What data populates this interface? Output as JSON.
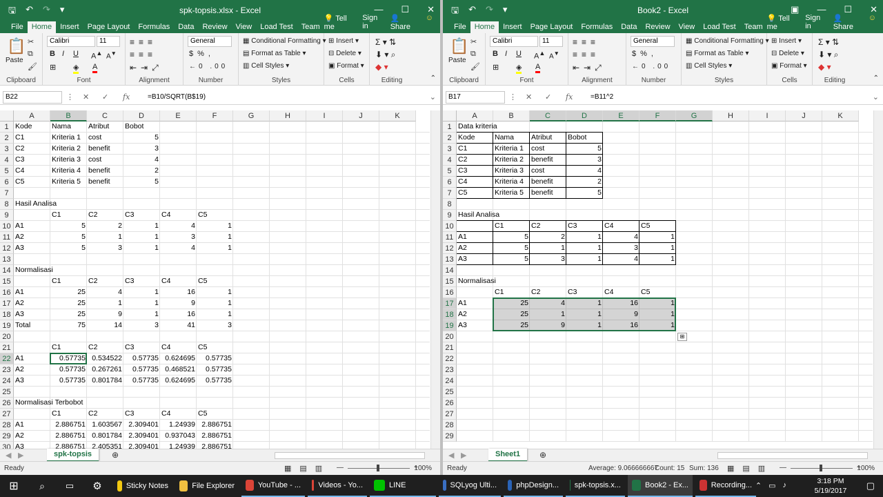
{
  "left": {
    "title": "spk-topsis.xlsx - Excel",
    "tabs": [
      "File",
      "Home",
      "Insert",
      "Page Layout",
      "Formulas",
      "Data",
      "Review",
      "View",
      "Load Test",
      "Team"
    ],
    "tell_me": "Tell me",
    "sign_in": "Sign in",
    "share": "Share",
    "ribbon": {
      "clipboard": "Clipboard",
      "paste": "Paste",
      "font_name": "Calibri",
      "font_size": "11",
      "font": "Font",
      "alignment": "Alignment",
      "number_format": "General",
      "number": "Number",
      "cond_fmt": "Conditional Formatting",
      "fmt_table": "Format as Table",
      "cell_styles": "Cell Styles",
      "styles": "Styles",
      "insert": "Insert",
      "delete": "Delete",
      "format": "Format",
      "cells": "Cells",
      "editing": "Editing"
    },
    "name_box": "B22",
    "formula": "=B10/SQRT(B$19)",
    "columns": [
      "A",
      "B",
      "C",
      "D",
      "E",
      "F",
      "G",
      "H",
      "I",
      "J",
      "K"
    ],
    "rows": [
      [
        "Kode",
        "Nama",
        "Atribut",
        "Bobot",
        "",
        ""
      ],
      [
        "C1",
        "Kriteria 1",
        "cost",
        "5",
        "",
        ""
      ],
      [
        "C2",
        "Kriteria 2",
        "benefit",
        "3",
        "",
        ""
      ],
      [
        "C3",
        "Kriteria 3",
        "cost",
        "4",
        "",
        ""
      ],
      [
        "C4",
        "Kriteria 4",
        "benefit",
        "2",
        "",
        ""
      ],
      [
        "C5",
        "Kriteria 5",
        "benefit",
        "5",
        "",
        ""
      ],
      [
        "",
        "",
        "",
        "",
        "",
        ""
      ],
      [
        "Hasil Analisa",
        "",
        "",
        "",
        "",
        ""
      ],
      [
        "",
        "C1",
        "C2",
        "C3",
        "C4",
        "C5"
      ],
      [
        "A1",
        "5",
        "2",
        "1",
        "4",
        "1"
      ],
      [
        "A2",
        "5",
        "1",
        "1",
        "3",
        "1"
      ],
      [
        "A3",
        "5",
        "3",
        "1",
        "4",
        "1"
      ],
      [
        "",
        "",
        "",
        "",
        "",
        ""
      ],
      [
        "Normalisasi",
        "",
        "",
        "",
        "",
        ""
      ],
      [
        "",
        "C1",
        "C2",
        "C3",
        "C4",
        "C5"
      ],
      [
        "A1",
        "25",
        "4",
        "1",
        "16",
        "1"
      ],
      [
        "A2",
        "25",
        "1",
        "1",
        "9",
        "1"
      ],
      [
        "A3",
        "25",
        "9",
        "1",
        "16",
        "1"
      ],
      [
        "Total",
        "75",
        "14",
        "3",
        "41",
        "3"
      ],
      [
        "",
        "",
        "",
        "",
        "",
        ""
      ],
      [
        "",
        "C1",
        "C2",
        "C3",
        "C4",
        "C5"
      ],
      [
        "A1",
        "0.57735",
        "0.534522",
        "0.57735",
        "0.624695",
        "0.57735"
      ],
      [
        "A2",
        "0.57735",
        "0.267261",
        "0.57735",
        "0.468521",
        "0.57735"
      ],
      [
        "A3",
        "0.57735",
        "0.801784",
        "0.57735",
        "0.624695",
        "0.57735"
      ],
      [
        "",
        "",
        "",
        "",
        "",
        ""
      ],
      [
        "Normalisasi Terbobot",
        "",
        "",
        "",
        "",
        ""
      ],
      [
        "",
        "C1",
        "C2",
        "C3",
        "C4",
        "C5"
      ],
      [
        "A1",
        "2.886751",
        "1.603567",
        "2.309401",
        "1.24939",
        "2.886751"
      ],
      [
        "A2",
        "2.886751",
        "0.801784",
        "2.309401",
        "0.937043",
        "2.886751"
      ],
      [
        "A3",
        "2.886751",
        "2.405351",
        "2.309401",
        "1.24939",
        "2.886751"
      ]
    ],
    "sheet_tab": "spk-topsis",
    "status": "Ready",
    "zoom": "100%"
  },
  "right": {
    "title": "Book2 - Excel",
    "tabs": [
      "File",
      "Home",
      "Insert",
      "Page Layout",
      "Formulas",
      "Data",
      "Review",
      "View",
      "Load Test",
      "Team"
    ],
    "tell_me": "Tell me",
    "sign_in": "Sign in",
    "share": "Share",
    "ribbon": {
      "clipboard": "Clipboard",
      "paste": "Paste",
      "font_name": "Calibri",
      "font_size": "11",
      "font": "Font",
      "alignment": "Alignment",
      "number_format": "General",
      "number": "Number",
      "cond_fmt": "Conditional Formatting",
      "fmt_table": "Format as Table",
      "cell_styles": "Cell Styles",
      "styles": "Styles",
      "insert": "Insert",
      "delete": "Delete",
      "format": "Format",
      "cells": "Cells",
      "editing": "Editing"
    },
    "name_box": "B17",
    "formula": "=B11^2",
    "columns": [
      "A",
      "B",
      "C",
      "D",
      "E",
      "F",
      "G",
      "H",
      "I",
      "J",
      "K"
    ],
    "rows": [
      [
        "Data kriteria",
        "",
        "",
        "",
        "",
        ""
      ],
      [
        "Kode",
        "Nama",
        "Atribut",
        "Bobot",
        "",
        ""
      ],
      [
        "C1",
        "Kriteria 1",
        "cost",
        "5",
        "",
        ""
      ],
      [
        "C2",
        "Kriteria 2",
        "benefit",
        "3",
        "",
        ""
      ],
      [
        "C3",
        "Kriteria 3",
        "cost",
        "4",
        "",
        ""
      ],
      [
        "C4",
        "Kriteria 4",
        "benefit",
        "2",
        "",
        ""
      ],
      [
        "C5",
        "Kriteria 5",
        "benefit",
        "5",
        "",
        ""
      ],
      [
        "",
        "",
        "",
        "",
        "",
        ""
      ],
      [
        "Hasil Analisa",
        "",
        "",
        "",
        "",
        ""
      ],
      [
        "",
        "C1",
        "C2",
        "C3",
        "C4",
        "C5"
      ],
      [
        "A1",
        "5",
        "2",
        "1",
        "4",
        "1"
      ],
      [
        "A2",
        "5",
        "1",
        "1",
        "3",
        "1"
      ],
      [
        "A3",
        "5",
        "3",
        "1",
        "4",
        "1"
      ],
      [
        "",
        "",
        "",
        "",
        "",
        ""
      ],
      [
        "Normalisasi",
        "",
        "",
        "",
        "",
        ""
      ],
      [
        "",
        "C1",
        "C2",
        "C3",
        "C4",
        "C5"
      ],
      [
        "A1",
        "25",
        "4",
        "1",
        "16",
        "1"
      ],
      [
        "A2",
        "25",
        "1",
        "1",
        "9",
        "1"
      ],
      [
        "A3",
        "25",
        "9",
        "1",
        "16",
        "1"
      ],
      [
        "",
        "",
        "",
        "",
        "",
        ""
      ],
      [
        "",
        "",
        "",
        "",
        "",
        ""
      ],
      [
        "",
        "",
        "",
        "",
        "",
        ""
      ],
      [
        "",
        "",
        "",
        "",
        "",
        ""
      ],
      [
        "",
        "",
        "",
        "",
        "",
        ""
      ],
      [
        "",
        "",
        "",
        "",
        "",
        ""
      ],
      [
        "",
        "",
        "",
        "",
        "",
        ""
      ],
      [
        "",
        "",
        "",
        "",
        "",
        ""
      ],
      [
        "",
        "",
        "",
        "",
        "",
        ""
      ],
      [
        "",
        "",
        "",
        "",
        "",
        ""
      ]
    ],
    "sheet_tab": "Sheet1",
    "status": "Ready",
    "average": "Average: 9.066666667",
    "count": "Count: 15",
    "sum": "Sum: 136",
    "zoom": "100%"
  },
  "taskbar": {
    "items": [
      "Sticky Notes",
      "File Explorer",
      "YouTube - ...",
      "Videos - Yo...",
      "LINE",
      "SQLyog Ulti...",
      "phpDesign...",
      "spk-topsis.x...",
      "Book2 - Ex...",
      "Recording..."
    ],
    "time": "3:18 PM",
    "date": "5/19/2017"
  }
}
